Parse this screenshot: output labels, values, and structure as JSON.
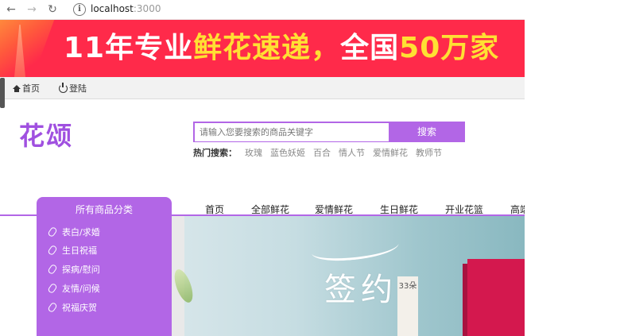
{
  "browser": {
    "url_host": "localhost",
    "url_port": ":3000",
    "info_glyph": "i"
  },
  "banner": {
    "parts": [
      {
        "text": "11年专业",
        "color": "#ffffff"
      },
      {
        "text": "鲜花速递，",
        "color": "#ffe033"
      },
      {
        "text": "全国",
        "color": "#ffffff"
      },
      {
        "text": "50万家",
        "color": "#ffe033"
      }
    ],
    "background": "#ff2a4a"
  },
  "topnav": {
    "home": "首页",
    "login": "登陆"
  },
  "logo": "花颂",
  "search": {
    "placeholder": "请输入您要搜索的商品关键字",
    "button": "搜索",
    "hot_label": "热门搜索：",
    "hot_terms": [
      "玫瑰",
      "蓝色妖姬",
      "百合",
      "情人节",
      "爱情鲜花",
      "教师节"
    ]
  },
  "categories": {
    "title": "所有商品分类",
    "items": [
      "表白/求婚",
      "生日祝福",
      "探病/慰问",
      "友情/问候",
      "祝福庆贺"
    ]
  },
  "mainnav": [
    "首页",
    "全部鲜花",
    "爱情鲜花",
    "生日鲜花",
    "开业花篮",
    "高端"
  ],
  "hero": {
    "title": "签约",
    "tag": "33朵"
  },
  "theme": {
    "accent": "#b266e6"
  }
}
